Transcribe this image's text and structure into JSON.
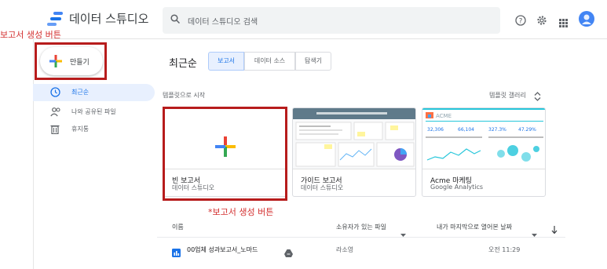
{
  "app": {
    "title": "데이터 스튜디오"
  },
  "search": {
    "placeholder": "데이터 스튜디오 검색"
  },
  "create": {
    "label": "만들기"
  },
  "annotations": {
    "left_note": "보고서 생성 버튼",
    "bottom_note": "*보고서 생성 버튼"
  },
  "sidebar": {
    "items": [
      {
        "label": "최근순",
        "icon": "clock-icon",
        "active": true
      },
      {
        "label": "나와 공유된 파일",
        "icon": "shared-people-icon",
        "active": false
      },
      {
        "label": "휴지통",
        "icon": "trash-icon",
        "active": false
      }
    ]
  },
  "main": {
    "heading": "최근순",
    "tabs": [
      {
        "label": "보고서",
        "active": true
      },
      {
        "label": "데이터 소스",
        "active": false
      },
      {
        "label": "탐색기",
        "active": false
      }
    ],
    "template_header": "템플릿으로 시작",
    "template_gallery": "템플릿 갤러리",
    "cards": [
      {
        "name": "빈 보고서",
        "sub": "데이터 스튜디오"
      },
      {
        "name": "가이드 보고서",
        "sub": "데이터 스튜디오"
      },
      {
        "name": "Acme 마케팅",
        "sub": "Google Analytics"
      }
    ]
  },
  "table": {
    "headers": {
      "name": "이름",
      "owner": "소유자가 있는 파일",
      "opened": "내가 마지막으로 열어본 날짜"
    },
    "rows": [
      {
        "name": "00업체 성과보고서_노마드",
        "owner": "라소영",
        "opened": "오전 11:29"
      }
    ]
  },
  "acme": {
    "brand": "ACME",
    "metrics": [
      "32,306",
      "66,104",
      "327.3%",
      "47.29%"
    ]
  },
  "colors": {
    "accent_blue": "#1a73e8",
    "annotation_red": "#b71c1c",
    "plus_red": "#ea4335",
    "plus_yellow": "#fbbc04",
    "plus_green": "#34a853",
    "plus_blue": "#4285f4",
    "acme_teal": "#26c6da"
  }
}
